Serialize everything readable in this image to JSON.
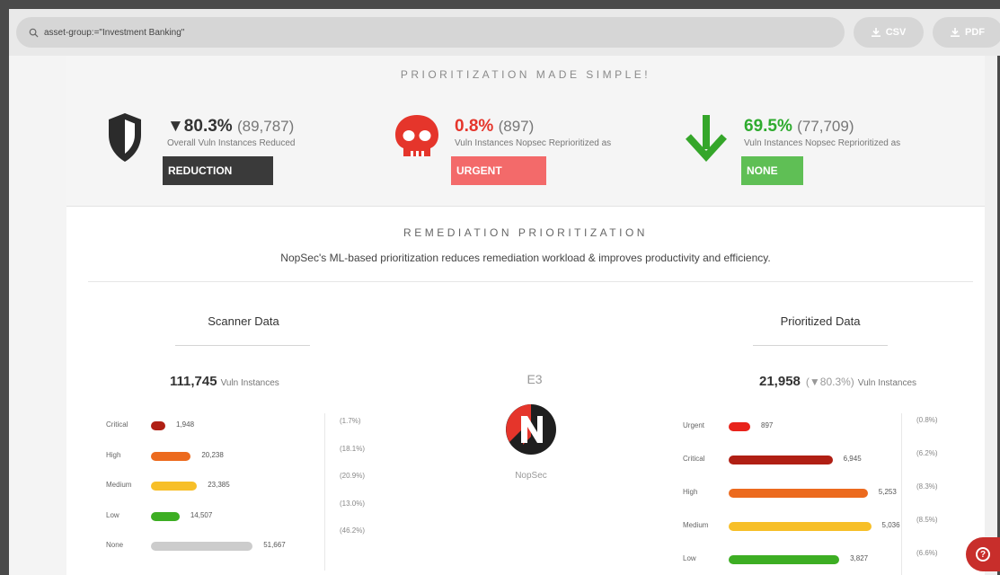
{
  "search": {
    "query": "asset-group:=\"Investment Banking\""
  },
  "toolbar": {
    "csv_label": "CSV",
    "pdf_label": "PDF"
  },
  "prioritization": {
    "title": "PRIORITIZATION MADE SIMPLE!",
    "reduction": {
      "pct": "▼80.3%",
      "count": "(89,787)",
      "desc": "Overall Vuln Instances Reduced",
      "tag": "REDUCTION",
      "color": "#3a3a3a"
    },
    "urgent": {
      "pct": "0.8%",
      "count": "(897)",
      "desc": "Vuln Instances Nopsec Reprioritized as",
      "tag": "URGENT",
      "color": "#f36a6a"
    },
    "none": {
      "pct": "69.5%",
      "count": "(77,709)",
      "desc": "Vuln Instances Nopsec Reprioritized as",
      "tag": "NONE",
      "color": "#5fbf55"
    }
  },
  "remediation": {
    "title": "REMEDIATION PRIORITIZATION",
    "subtitle": "NopSec's ML-based prioritization reduces remediation workload & improves productivity and efficiency."
  },
  "scanner": {
    "title": "Scanner Data",
    "total": "111,745",
    "unit": "Vuln Instances",
    "rows": [
      {
        "label": "Critical",
        "value": "1,948",
        "pct": "(1.7%)",
        "fraction": 0.017,
        "color": "#b01f14"
      },
      {
        "label": "High",
        "value": "20,238",
        "pct": "(18.1%)",
        "fraction": 0.181,
        "color": "#ec6a1e"
      },
      {
        "label": "Medium",
        "value": "23,385",
        "pct": "(20.9%)",
        "fraction": 0.209,
        "color": "#f7bf28"
      },
      {
        "label": "Low",
        "value": "14,507",
        "pct": "(13.0%)",
        "fraction": 0.13,
        "color": "#3dae23"
      },
      {
        "label": "None",
        "value": "51,667",
        "pct": "(46.2%)",
        "fraction": 0.462,
        "color": "#cccccc"
      }
    ]
  },
  "center": {
    "label": "E3",
    "brand": "NopSec"
  },
  "prioritized": {
    "title": "Prioritized Data",
    "total": "21,958",
    "change": "(▼80.3%)",
    "unit": "Vuln Instances",
    "rows": [
      {
        "label": "Urgent",
        "value": "897",
        "pct": "(0.8%)",
        "fraction": 0.008,
        "color": "#e8231b"
      },
      {
        "label": "Critical",
        "value": "6,945",
        "pct": "(6.2%)",
        "fraction": 0.062,
        "color": "#b01f14"
      },
      {
        "label": "High",
        "value": "5,253",
        "pct": "(8.3%)",
        "fraction": 0.083,
        "color": "#ec6a1e"
      },
      {
        "label": "Medium",
        "value": "5,036",
        "pct": "(8.5%)",
        "fraction": 0.085,
        "color": "#f7bf28"
      },
      {
        "label": "Low",
        "value": "3,827",
        "pct": "(6.6%)",
        "fraction": 0.066,
        "color": "#3dae23"
      }
    ]
  },
  "help": {
    "icon": "question-icon"
  }
}
